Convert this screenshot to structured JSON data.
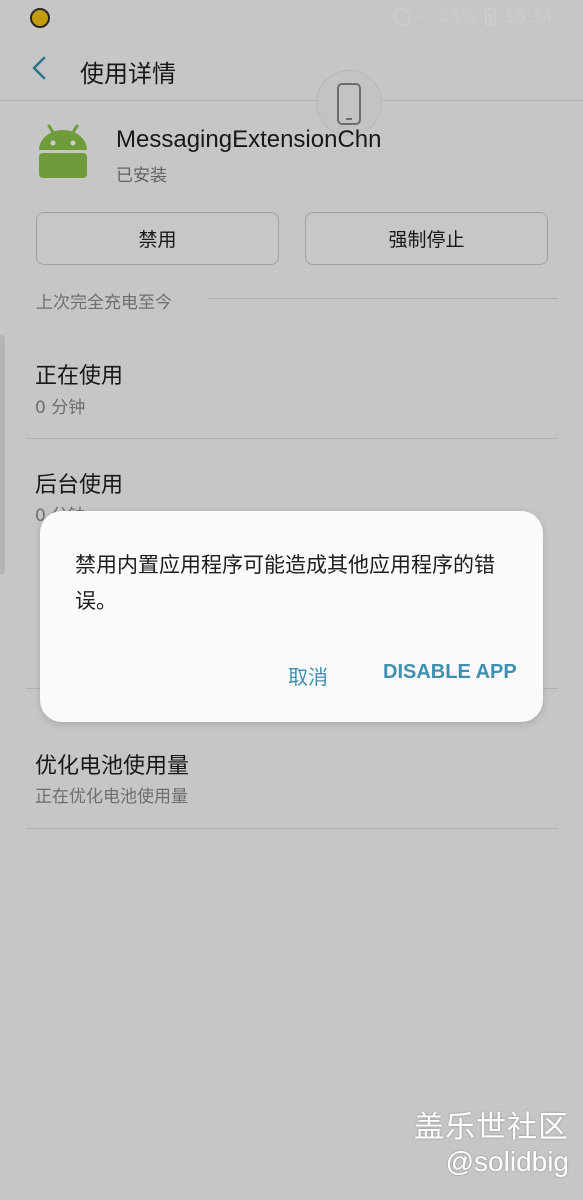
{
  "status_bar": {
    "battery_text": "55%",
    "time": "18:34",
    "signal_text": "4G"
  },
  "header": {
    "title": "使用详情",
    "back_icon": "chevron-left-icon"
  },
  "app": {
    "name": "MessagingExtensionChn",
    "status": "已安装",
    "icon": "android-icon"
  },
  "actions": {
    "disable_label": "禁用",
    "force_stop_label": "强制停止"
  },
  "section": {
    "label": "上次完全充电至今"
  },
  "rows": [
    {
      "title": "正在使用",
      "sub": "0 分钟"
    },
    {
      "title": "后台使用",
      "sub": "0 分钟"
    },
    {
      "title": "优化电池使用量",
      "sub": "正在优化电池使用量"
    }
  ],
  "dialog": {
    "message": "禁用内置应用程序可能造成其他应用程序的错误。",
    "cancel_label": "取消",
    "confirm_label": "DISABLE APP"
  },
  "watermark": {
    "line1": "盖乐世社区",
    "line2": "@solidbig"
  },
  "colors": {
    "accent": "#3e8fb0",
    "android_green": "#8bc34a"
  }
}
